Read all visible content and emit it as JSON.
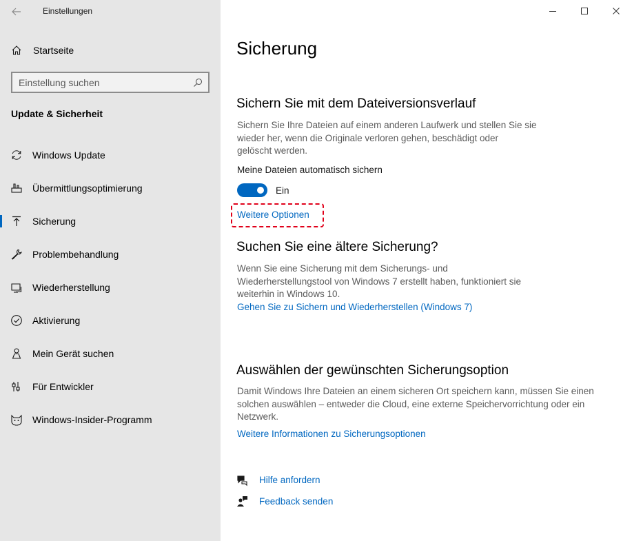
{
  "window": {
    "app_title": "Einstellungen"
  },
  "sidebar": {
    "home_label": "Startseite",
    "search_placeholder": "Einstellung suchen",
    "section_title": "Update & Sicherheit",
    "items": [
      {
        "label": "Windows Update",
        "icon": "refresh-icon"
      },
      {
        "label": "Übermittlungsoptimierung",
        "icon": "delivery-optimization-icon"
      },
      {
        "label": "Sicherung",
        "icon": "backup-arrow-icon",
        "active": true
      },
      {
        "label": "Problembehandlung",
        "icon": "wrench-icon"
      },
      {
        "label": "Wiederherstellung",
        "icon": "recovery-icon"
      },
      {
        "label": "Aktivierung",
        "icon": "check-circle-icon"
      },
      {
        "label": "Mein Gerät suchen",
        "icon": "person-location-icon"
      },
      {
        "label": "Für Entwickler",
        "icon": "developer-tools-icon"
      },
      {
        "label": "Windows-Insider-Programm",
        "icon": "insider-cat-icon"
      }
    ]
  },
  "main": {
    "page_title": "Sicherung",
    "file_history": {
      "heading": "Sichern Sie mit dem Dateiversionsverlauf",
      "description_lines": [
        "Sichern Sie Ihre Dateien auf einem anderen Laufwerk und stellen Sie sie",
        "wieder her, wenn die Originale verloren gehen, beschädigt oder",
        "gelöscht werden."
      ],
      "toggle_label": "Meine Dateien automatisch sichern",
      "toggle_state": "Ein",
      "toggle_on": true,
      "more_options_link": "Weitere Optionen"
    },
    "older_backup": {
      "heading": "Suchen Sie eine ältere Sicherung?",
      "description_lines": [
        "Wenn Sie eine Sicherung mit dem Sicherungs- und",
        "Wiederherstellungstool von Windows 7 erstellt haben, funktioniert sie",
        "weiterhin in Windows 10."
      ],
      "link": "Gehen Sie zu Sichern und Wiederherstellen (Windows 7)"
    },
    "choose_option": {
      "heading": "Auswählen der gewünschten Sicherungsoption",
      "description_lines": [
        "Damit Windows Ihre Dateien an einem sicheren Ort speichern kann, müssen Sie einen",
        "solchen auswählen – entweder die Cloud, eine externe Speichervorrichtung oder ein",
        "Netzwerk."
      ],
      "link": "Weitere Informationen zu Sicherungsoptionen"
    },
    "help_link": "Hilfe anfordern",
    "feedback_link": "Feedback senden"
  },
  "colors": {
    "accent": "#0067c0",
    "sidebar_bg": "#e6e6e6",
    "highlight_border": "#e0001a"
  }
}
